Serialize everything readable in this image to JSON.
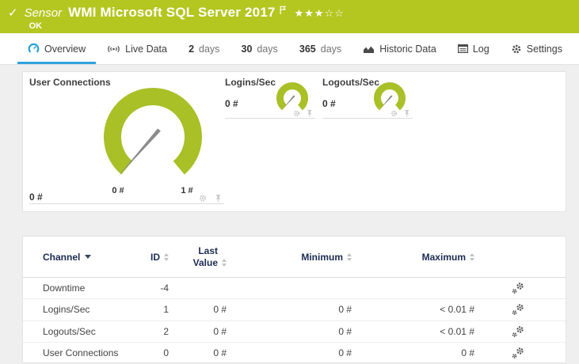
{
  "header": {
    "status_check": "✓",
    "kind": "Sensor",
    "title": "WMI Microsoft SQL Server 2017",
    "status": "OK",
    "stars_filled": "★★★",
    "stars_empty": "☆☆",
    "bg_color": "#b4c620"
  },
  "tabs": [
    {
      "label": "Overview",
      "icon": "gauge-icon",
      "active": true
    },
    {
      "label": "Live Data",
      "icon": "live-data-icon"
    },
    {
      "num": "2",
      "label": "days"
    },
    {
      "num": "30",
      "label": "days"
    },
    {
      "num": "365",
      "label": "days"
    },
    {
      "label": "Historic Data",
      "icon": "historic-data-icon"
    },
    {
      "label": "Log",
      "icon": "log-icon"
    },
    {
      "label": "Settings",
      "icon": "settings-gear-icon"
    }
  ],
  "accent": {
    "tab_underline": "#2fa3dc",
    "gauge_green": "#a9c027",
    "needle_gray": "#8c8c8c"
  },
  "gauges": {
    "primary": {
      "title": "User Connections",
      "value": "0 #",
      "scale_min_label": "0 #",
      "scale_max_label": "1 #"
    },
    "logins": {
      "title": "Logins/Sec",
      "value": "0 #"
    },
    "logouts": {
      "title": "Logouts/Sec",
      "value": "0 #"
    }
  },
  "table": {
    "col_channel": "Channel",
    "col_id": "ID",
    "col_last": "Last Value",
    "col_min": "Minimum",
    "col_max": "Maximum",
    "rows": [
      {
        "channel": "Downtime",
        "id": "-4",
        "last": "",
        "min": "",
        "max": ""
      },
      {
        "channel": "Logins/Sec",
        "id": "1",
        "last": "0 #",
        "min": "0 #",
        "max": "< 0.01 #"
      },
      {
        "channel": "Logouts/Sec",
        "id": "2",
        "last": "0 #",
        "min": "0 #",
        "max": "< 0.01 #"
      },
      {
        "channel": "User Connections",
        "id": "0",
        "last": "0 #",
        "min": "0 #",
        "max": "0 #"
      }
    ]
  }
}
